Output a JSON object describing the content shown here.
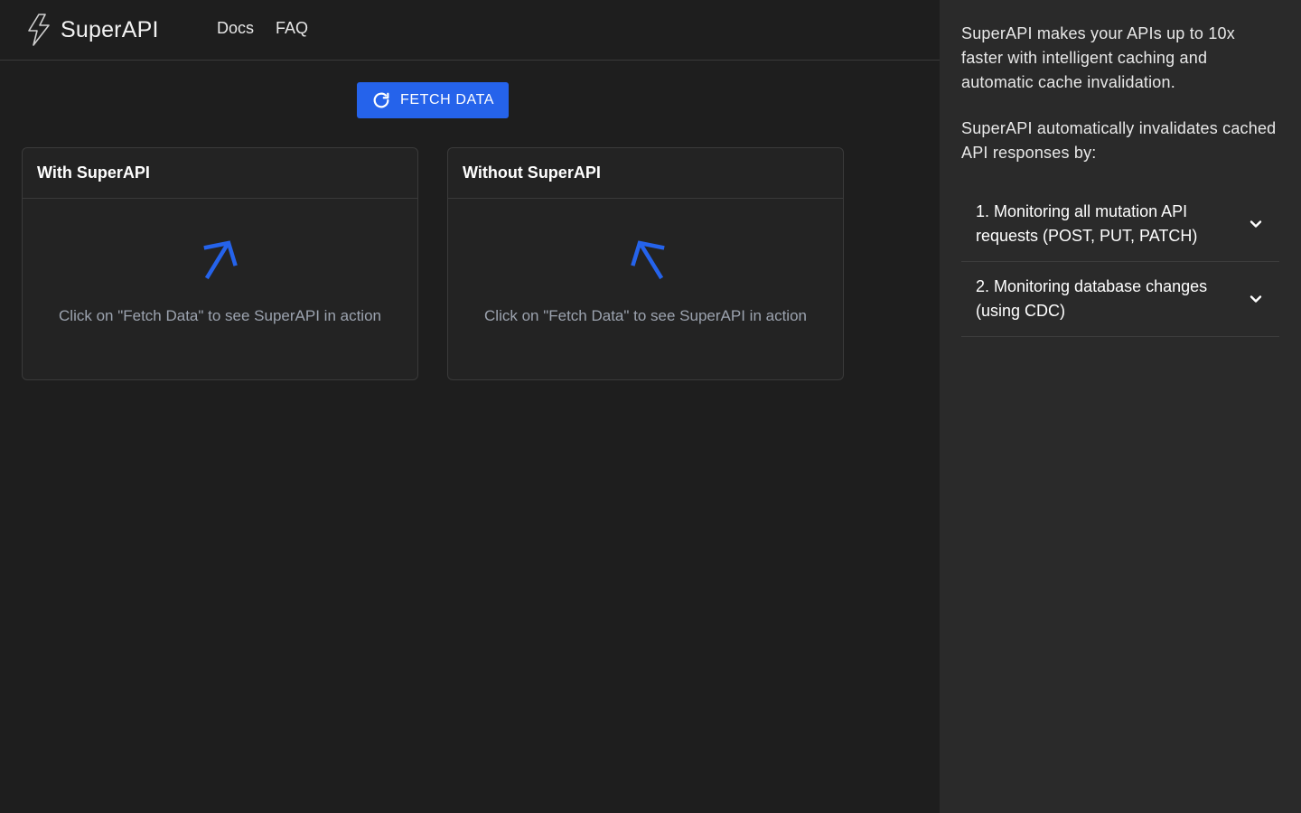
{
  "header": {
    "brand": "SuperAPI",
    "nav": [
      {
        "label": "Docs"
      },
      {
        "label": "FAQ"
      }
    ]
  },
  "toolbar": {
    "fetch_label": "FETCH DATA",
    "fetch_icon": "refresh-icon"
  },
  "panels": [
    {
      "title": "With SuperAPI",
      "message": "Click on \"Fetch Data\" to see SuperAPI in action",
      "icon": "arrow-up-right-icon"
    },
    {
      "title": "Without SuperAPI",
      "message": "Click on \"Fetch Data\" to see SuperAPI in action",
      "icon": "arrow-up-left-icon"
    }
  ],
  "sidebar": {
    "intro": "SuperAPI makes your APIs up to 10x faster with intelligent caching and automatic cache invalidation.",
    "sub": "SuperAPI automatically invalidates cached API responses by:",
    "accordion": [
      {
        "label": "1. Monitoring all mutation API requests (POST, PUT, PATCH)"
      },
      {
        "label": "2. Monitoring database changes (using CDC)"
      }
    ]
  },
  "colors": {
    "accent": "#2563eb",
    "background": "#1e1e1e",
    "sidebar": "#2a2a2a",
    "muted_text": "#9ca3af"
  }
}
